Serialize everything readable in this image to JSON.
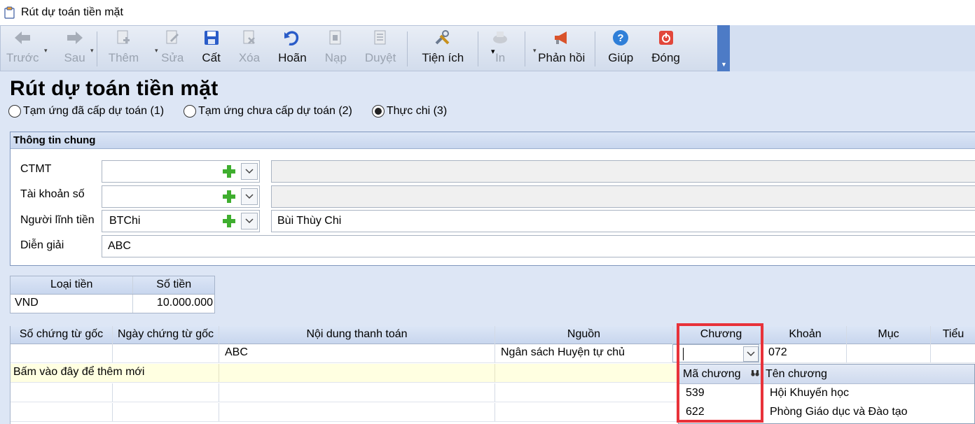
{
  "window": {
    "title": "Rút dự toán tiền mặt"
  },
  "toolbar": {
    "buttons": [
      {
        "id": "back",
        "label": "Trước",
        "icon": "arrow-left-icon",
        "enabled": false
      },
      {
        "id": "forward",
        "label": "Sau",
        "icon": "arrow-right-icon",
        "enabled": false
      },
      {
        "id": "add",
        "label": "Thêm",
        "icon": "add-document-icon",
        "enabled": false
      },
      {
        "id": "edit",
        "label": "Sửa",
        "icon": "edit-document-icon",
        "enabled": false
      },
      {
        "id": "save",
        "label": "Cất",
        "icon": "floppy-disk-icon",
        "enabled": true
      },
      {
        "id": "delete",
        "label": "Xóa",
        "icon": "delete-document-icon",
        "enabled": false
      },
      {
        "id": "undo",
        "label": "Hoãn",
        "icon": "undo-icon",
        "enabled": true
      },
      {
        "id": "post",
        "label": "Nạp",
        "icon": "post-icon",
        "enabled": false
      },
      {
        "id": "approve",
        "label": "Duyệt",
        "icon": "approve-icon",
        "enabled": false
      },
      {
        "id": "utilities",
        "label": "Tiện ích",
        "icon": "tools-icon",
        "enabled": true
      },
      {
        "id": "print",
        "label": "In",
        "icon": "printer-icon",
        "enabled": false
      },
      {
        "id": "feedback",
        "label": "Phản hồi",
        "icon": "megaphone-icon",
        "enabled": true
      },
      {
        "id": "help",
        "label": "Giúp",
        "icon": "help-icon",
        "enabled": true
      },
      {
        "id": "close",
        "label": "Đóng",
        "icon": "power-icon",
        "enabled": true
      }
    ]
  },
  "page": {
    "title": "Rút dự toán tiền mặt",
    "radios": [
      {
        "label": "Tạm ứng đã cấp dự toán (1)",
        "checked": false
      },
      {
        "label": "Tạm ứng chưa cấp dự toán (2)",
        "checked": false
      },
      {
        "label": "Thực chi (3)",
        "checked": true
      }
    ]
  },
  "general": {
    "title": "Thông tin chung",
    "ctmt": {
      "label": "CTMT",
      "code": "",
      "name": ""
    },
    "account": {
      "label": "Tài khoản số",
      "code": "",
      "name": ""
    },
    "receiver": {
      "label": "Người lĩnh tiền",
      "code": "BTChi",
      "name": "Bùi Thùy Chi"
    },
    "description": {
      "label": "Diễn giải",
      "value": "ABC"
    }
  },
  "currency_table": {
    "headers": [
      "Loại tiền",
      "Số tiền"
    ],
    "rows": [
      {
        "type": "VND",
        "amount": "10.000.000"
      }
    ]
  },
  "detail_grid": {
    "headers": [
      "Số chứng từ gốc",
      "Ngày chứng từ gốc",
      "Nội dung thanh toán",
      "Nguồn",
      "Chương",
      "Khoản",
      "Mục",
      "Tiểu"
    ],
    "rows": [
      {
        "doc_no": "",
        "doc_date": "",
        "content": "ABC",
        "source": "Ngân sách Huyện tự chủ",
        "chapter": "",
        "khoan": "072",
        "muc": "",
        "tieu": ""
      }
    ],
    "add_new_text": "Bấm vào đây để thêm mới"
  },
  "chapter_dropdown": {
    "headers": [
      "Mã chương",
      "Tên chương"
    ],
    "items": [
      {
        "code": "539",
        "name": "Hội Khuyến học"
      },
      {
        "code": "622",
        "name": "Phòng Giáo dục và Đào tạo"
      }
    ]
  },
  "colors": {
    "highlight": "#e8323a",
    "background": "#dde6f5",
    "add_row": "#ffffe1",
    "toolbar_accent": "#4d7bc6"
  }
}
